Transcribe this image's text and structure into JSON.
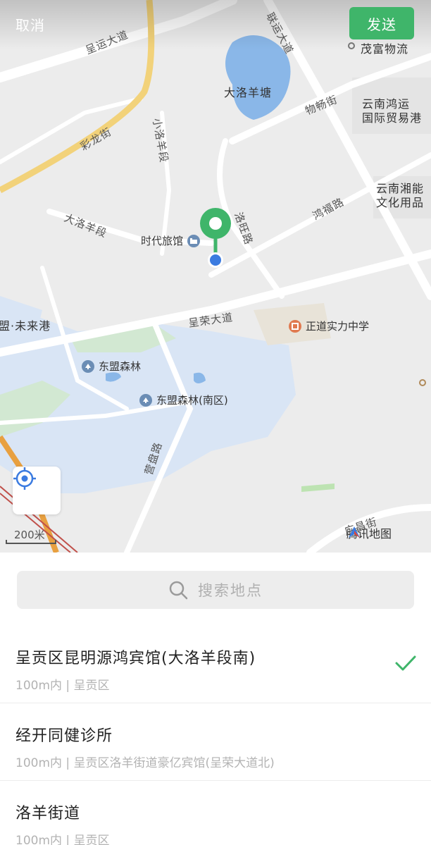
{
  "header": {
    "cancel_label": "取消",
    "send_label": "发送"
  },
  "map": {
    "roads": {
      "chenggong_avenue_top": "呈运大道",
      "lianyun_avenue": "联运大道",
      "wuchang_street": "物畅街",
      "cailong_street": "彩龙街",
      "xiaoluoyang_section": "小洛羊段",
      "daluoyang_section": "大洛羊段",
      "luowang_road": "洛旺路",
      "hongfu_road": "鸿福路",
      "chengrong_avenue": "呈荣大道",
      "yingpan_road": "营盘路",
      "guangchang_street": "广昌街"
    },
    "places": {
      "lake": "大洛羊塘",
      "maofu": "茂富物流",
      "yunnan_hongyun": "云南鸿运\n国际贸易港",
      "yunnan_xiangneng": "云南湘能\n文化用品",
      "shidai_hotel": "时代旅馆",
      "zhengdao_school": "正道实力中学",
      "dongmeng_forest": "东盟森林",
      "dongmeng_forest_south": "东盟森林(南区)",
      "future_port": "盟·未来港"
    },
    "scale_label": "200米",
    "brand_label": "腾讯地图",
    "icons": {
      "locate": "locate-icon",
      "pin": "location-pin-icon"
    }
  },
  "search": {
    "placeholder": "搜索地点",
    "icon": "search-icon"
  },
  "results": [
    {
      "name": "呈贡区昆明源鸿宾馆(大洛羊段南)",
      "address": "100m内 | 呈贡区",
      "selected": true
    },
    {
      "name": "经开同健诊所",
      "address": "100m内 | 呈贡区洛羊街道豪亿宾馆(呈荣大道北)",
      "selected": false
    },
    {
      "name": "洛羊街道",
      "address": "100m内 | 呈贡区",
      "selected": false
    }
  ],
  "colors": {
    "accent": "#3fb56a",
    "map_bg": "#ececec",
    "water": "#7fb0e6",
    "park": "#d6e4f5"
  }
}
